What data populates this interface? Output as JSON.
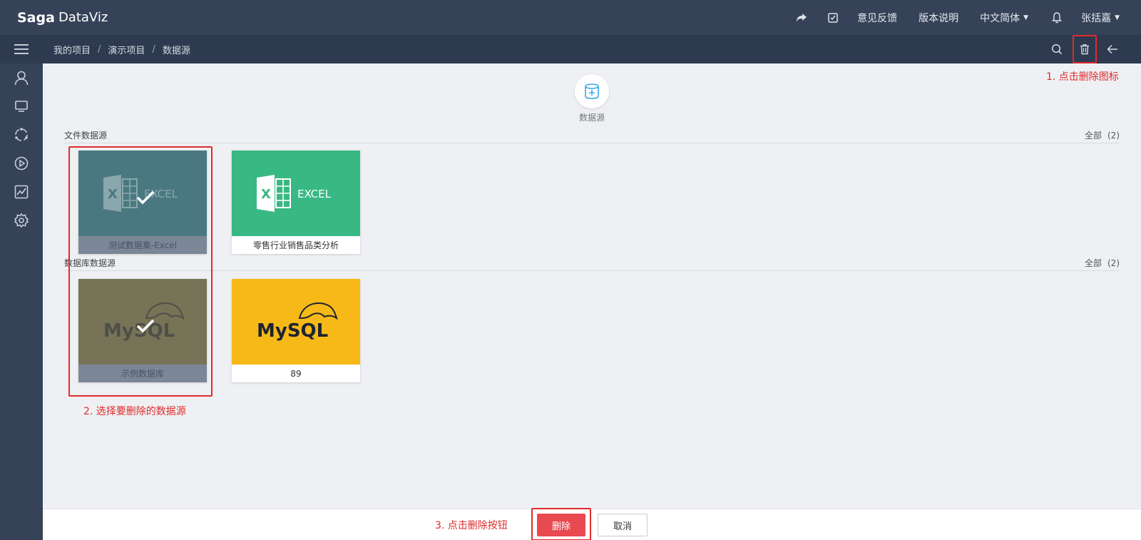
{
  "app": {
    "brand": "Saga",
    "product": "DataViz"
  },
  "topbar": {
    "links": [
      "意见反馈",
      "版本说明"
    ],
    "language": "中文简体",
    "user": "张括嘉"
  },
  "breadcrumb": [
    "我的项目",
    "演示项目",
    "数据源"
  ],
  "add_datasource": {
    "label": "数据源"
  },
  "sections": {
    "file": {
      "title": "文件数据源",
      "all_label": "全部",
      "count": "(2)"
    },
    "db": {
      "title": "数据库数据源",
      "all_label": "全部",
      "count": "(2)"
    }
  },
  "cards": {
    "file": [
      {
        "name": "测试数据集-Excel",
        "logo": "EXCEL",
        "selected": true
      },
      {
        "name": "零售行业销售品类分析",
        "logo": "EXCEL",
        "selected": false
      }
    ],
    "db": [
      {
        "name": "示例数据库",
        "logo": "MySQL",
        "selected": true
      },
      {
        "name": "89",
        "logo": "MySQL",
        "selected": false
      }
    ]
  },
  "annotations": {
    "step1": "1. 点击删除图标",
    "step2": "2. 选择要删除的数据源",
    "step3": "3. 点击删除按钮"
  },
  "footer": {
    "delete_label": "删除",
    "cancel_label": "取消"
  },
  "colors": {
    "topbar": "#354258",
    "accent_red": "#e02b2b",
    "excel_green": "#38b883",
    "mysql_yellow": "#f6b917",
    "delete_button": "#e84a50"
  }
}
